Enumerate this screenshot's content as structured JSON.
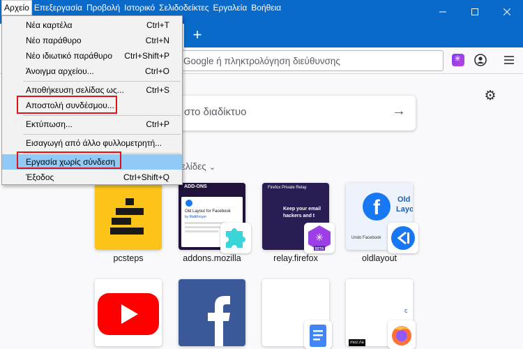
{
  "menubar": {
    "items": [
      {
        "label": "Αρχείο"
      },
      {
        "label": "Επεξεργασία"
      },
      {
        "label": "Προβολή"
      },
      {
        "label": "Ιστορικό"
      },
      {
        "label": "Σελιδοδείκτες"
      },
      {
        "label": "Εργαλεία"
      },
      {
        "label": "Βοήθεια"
      }
    ]
  },
  "file_menu": {
    "items": [
      {
        "label": "Νέα καρτέλα",
        "shortcut": "Ctrl+T"
      },
      {
        "label": "Νέο παράθυρο",
        "shortcut": "Ctrl+N"
      },
      {
        "label": "Νέο ιδιωτικό παράθυρο",
        "shortcut": "Ctrl+Shift+P"
      },
      {
        "label": "Άνοιγμα αρχείου...",
        "shortcut": "Ctrl+O"
      },
      {
        "label": "Αποθήκευση σελίδας ως...",
        "shortcut": "Ctrl+S"
      },
      {
        "label": "Αποστολή συνδέσμου...",
        "shortcut": ""
      },
      {
        "label": "Εκτύπωση...",
        "shortcut": "Ctrl+P"
      },
      {
        "label": "Εισαγωγή από άλλο φυλλομετρητή...",
        "shortcut": ""
      },
      {
        "label": "Εργασία χωρίς σύνδεση",
        "shortcut": ""
      },
      {
        "label": "Έξοδος",
        "shortcut": "Ctrl+Shift+Q"
      }
    ]
  },
  "urlbar": {
    "placeholder": "Google ή πληκτρολόγηση διεύθυνσης"
  },
  "search": {
    "placeholder": "στο διαδίκτυο"
  },
  "shortcuts": {
    "title": "ελίδες",
    "tiles": [
      {
        "label": "pcsteps"
      },
      {
        "label": "addons.mozilla"
      },
      {
        "label": "relay.firefox"
      },
      {
        "label": "oldlayout"
      }
    ]
  },
  "thumb_text": {
    "addons_heading": "ADD-ONS",
    "addons_card_title": "Old Layout for Facebook",
    "addons_card_author": "by MattKroyer",
    "relay_brand": "Firefox Private Relay",
    "relay_line1": "Keep your email",
    "relay_line2": "hackers and t",
    "relay_badge": "BETA",
    "oldlayout_text1": "Old",
    "oldlayout_text2": "Layo",
    "oldlayout_caption": "Undo Facebook",
    "mozilla_badge": "moz://a"
  },
  "colors": {
    "titlebar": "#0a6ac9",
    "highlight": "#91c9f7",
    "annotation_red": "#e0131b"
  }
}
